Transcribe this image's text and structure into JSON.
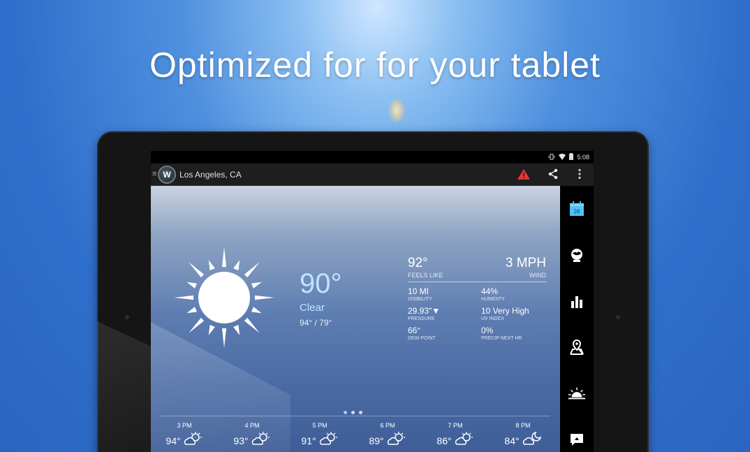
{
  "headline": "Optimized for for your tablet",
  "status_bar": {
    "time": "5:08",
    "icons": [
      "vibrate-icon",
      "wifi-icon",
      "battery-icon"
    ]
  },
  "app_bar": {
    "logo_text": "W",
    "location": "Los Angeles, CA",
    "actions": [
      "alert-icon",
      "share-icon",
      "more-icon"
    ]
  },
  "current": {
    "temperature": "90°",
    "condition": "Clear",
    "hi_lo": "94° / 79°",
    "feels_like_value": "92°",
    "feels_like_label": "FEELS LIKE",
    "wind_value": "3 MPH",
    "wind_label": "WIND",
    "stats": [
      {
        "value": "10 MI",
        "label": "VISIBILITY"
      },
      {
        "value": "44%",
        "label": "HUMIDITY"
      },
      {
        "value": "29.93\"▼",
        "label": "PRESSURE"
      },
      {
        "value": "10 Very High",
        "label": "UV INDEX"
      },
      {
        "value": "66°",
        "label": "DEW POINT"
      },
      {
        "value": "0%",
        "label": "PRECIP NEXT HR"
      }
    ]
  },
  "pager": {
    "count": 3,
    "active": 1
  },
  "hourly": [
    {
      "time": "3 PM",
      "temp": "94°",
      "icon": "partly-cloudy-icon"
    },
    {
      "time": "4 PM",
      "temp": "93°",
      "icon": "partly-cloudy-icon"
    },
    {
      "time": "5 PM",
      "temp": "91°",
      "icon": "partly-cloudy-icon"
    },
    {
      "time": "6 PM",
      "temp": "89°",
      "icon": "partly-cloudy-icon"
    },
    {
      "time": "7 PM",
      "temp": "86°",
      "icon": "partly-cloudy-icon"
    },
    {
      "time": "8 PM",
      "temp": "84°",
      "icon": "partly-cloudy-night-icon"
    }
  ],
  "sidebar": {
    "calendar_day": "26",
    "items": [
      "calendar-icon",
      "radar-globe-icon",
      "bar-chart-icon",
      "map-pin-icon",
      "sunrise-icon",
      "chat-icon"
    ]
  },
  "colors": {
    "accent": "#bfe3ff",
    "alert": "#e53935",
    "calendar": "#4fc3f7"
  }
}
